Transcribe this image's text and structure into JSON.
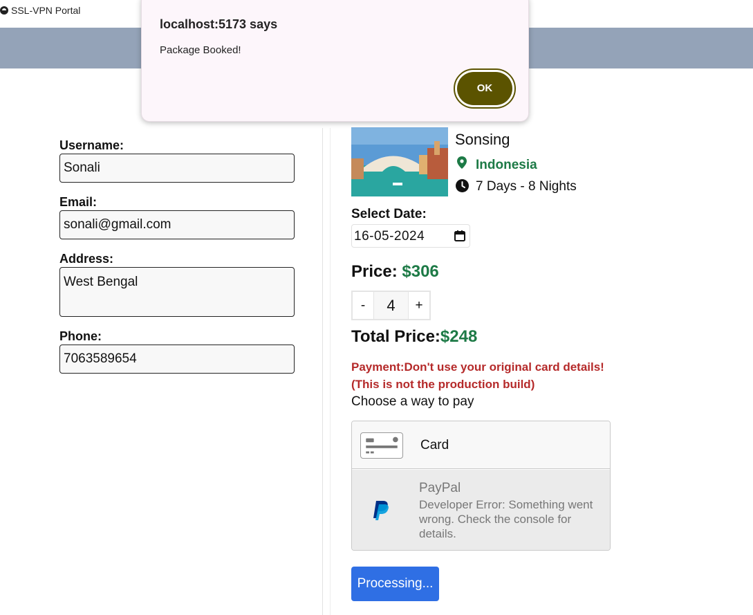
{
  "browser": {
    "tab_title": "SSL-VPN Portal"
  },
  "dialog": {
    "title": "localhost:5173 says",
    "message": "Package Booked!",
    "ok_label": "OK"
  },
  "form": {
    "username_label": "Username:",
    "username_value": "Sonali",
    "email_label": "Email:",
    "email_value": "sonali@gmail.com",
    "address_label": "Address:",
    "address_value": "West Bengal",
    "phone_label": "Phone:",
    "phone_value": "7063589654"
  },
  "package": {
    "name": "Sonsing",
    "location": "Indonesia",
    "duration": "7 Days - 8 Nights",
    "date_label": "Select Date:",
    "date_value": "16-05-2024",
    "price_label": "Price: ",
    "price_value": "$306",
    "quantity": "4",
    "decrement_label": "-",
    "increment_label": "+",
    "total_label": "Total Price:",
    "total_value": "$248"
  },
  "payment": {
    "warning_line1": "Payment:Don't use your original card details!",
    "warning_line2": "(This is not the production build)",
    "choose_label": "Choose a way to pay",
    "card_label": "Card",
    "paypal_label": "PayPal",
    "paypal_error": "Developer Error: Something went wrong. Check the console for details.",
    "process_button": "Processing..."
  },
  "colors": {
    "navbar": "#94a3b8",
    "price_green": "#1d7a46",
    "warning_red": "#b52a2a",
    "primary_button": "#2f6fe4",
    "dialog_ok": "#5b5300"
  },
  "icons": [
    "location-pin-icon",
    "clock-icon",
    "calendar-icon",
    "credit-card-icon",
    "paypal-icon",
    "browser-tab-icon"
  ]
}
